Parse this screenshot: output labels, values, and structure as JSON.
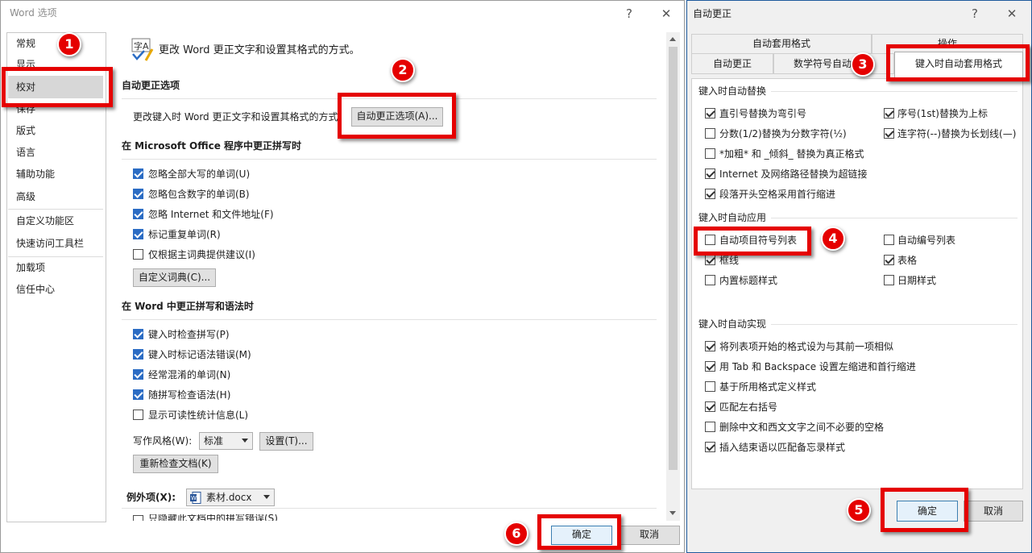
{
  "left_dialog": {
    "title": "Word 选项",
    "help": "?",
    "close": "✕",
    "nav": [
      "常规",
      "显示",
      "校对",
      "保存",
      "版式",
      "语言",
      "辅助功能",
      "高级",
      "自定义功能区",
      "快速访问工具栏",
      "加载项",
      "信任中心"
    ],
    "intro": "更改 Word 更正文字和设置其格式的方式。",
    "autocorrect_header": "自动更正选项",
    "autocorrect_desc": "更改键入时 Word 更正文字和设置其格式的方式：",
    "autocorrect_button": "自动更正选项(A)...",
    "office_header": "在 Microsoft Office 程序中更正拼写时",
    "office_options": [
      {
        "label": "忽略全部大写的单词(U)",
        "checked": true
      },
      {
        "label": "忽略包含数字的单词(B)",
        "checked": true
      },
      {
        "label": "忽略 Internet 和文件地址(F)",
        "checked": true
      },
      {
        "label": "标记重复单词(R)",
        "checked": true
      },
      {
        "label": "仅根据主词典提供建议(I)",
        "checked": false
      }
    ],
    "custom_dict_button": "自定义词典(C)...",
    "word_header": "在 Word 中更正拼写和语法时",
    "word_options": [
      {
        "label": "键入时检查拼写(P)",
        "checked": true
      },
      {
        "label": "键入时标记语法错误(M)",
        "checked": true
      },
      {
        "label": "经常混淆的单词(N)",
        "checked": true
      },
      {
        "label": "随拼写检查语法(H)",
        "checked": true
      },
      {
        "label": "显示可读性统计信息(L)",
        "checked": false
      }
    ],
    "writing_style_label": "写作风格(W):",
    "writing_style_value": "标准",
    "settings_button": "设置(T)...",
    "recheck_button": "重新检查文档(K)",
    "exceptions_label": "例外项(X):",
    "exceptions_file": "素材.docx",
    "cut_option": "只隐藏此文档中的拼写错误(S)",
    "ok": "确定",
    "cancel": "取消"
  },
  "right_dialog": {
    "title": "自动更正",
    "help": "?",
    "close": "✕",
    "tabs_top": [
      "自动套用格式",
      "操作"
    ],
    "tabs_bottom": [
      "自动更正",
      "数学符号自动",
      "键入时自动套用格式"
    ],
    "replace_header": "键入时自动替换",
    "replace_left": [
      {
        "label": "直引号替换为弯引号",
        "checked": true
      },
      {
        "label": "分数(1/2)替换为分数字符(½)",
        "checked": false
      },
      {
        "label": "*加粗* 和 _倾斜_ 替换为真正格式",
        "checked": false
      },
      {
        "label": "Internet 及网络路径替换为超链接",
        "checked": true
      },
      {
        "label": "段落开头空格采用首行缩进",
        "checked": true
      }
    ],
    "replace_right": [
      {
        "label": "序号(1st)替换为上标",
        "checked": true
      },
      {
        "label": "连字符(--)替换为长划线(—)",
        "checked": true
      }
    ],
    "apply_header": "键入时自动应用",
    "apply_left": [
      {
        "label": "自动项目符号列表",
        "checked": false
      },
      {
        "label": "框线",
        "checked": true
      },
      {
        "label": "内置标题样式",
        "checked": false
      }
    ],
    "apply_right": [
      {
        "label": "自动编号列表",
        "checked": false
      },
      {
        "label": "表格",
        "checked": true
      },
      {
        "label": "日期样式",
        "checked": false
      }
    ],
    "implement_header": "键入时自动实现",
    "implement": [
      {
        "label": "将列表项开始的格式设为与其前一项相似",
        "checked": true
      },
      {
        "label": "用 Tab 和 Backspace 设置左缩进和首行缩进",
        "checked": true
      },
      {
        "label": "基于所用格式定义样式",
        "checked": false
      },
      {
        "label": "匹配左右括号",
        "checked": true
      },
      {
        "label": "删除中文和西文文字之间不必要的空格",
        "checked": false
      },
      {
        "label": "插入结束语以匹配备忘录样式",
        "checked": true
      }
    ],
    "ok": "确定",
    "cancel": "取消"
  },
  "markers": [
    "1",
    "2",
    "3",
    "4",
    "5",
    "6"
  ],
  "colors": {
    "annotation_red": "#e50000",
    "checkbox_blue": "#2b6cc4",
    "selected_nav": "#d7d7d7",
    "dialog_border": "#1e5a9c"
  },
  "icons": {
    "proofing": "proofing-icon",
    "word_doc": "word-document-icon"
  }
}
